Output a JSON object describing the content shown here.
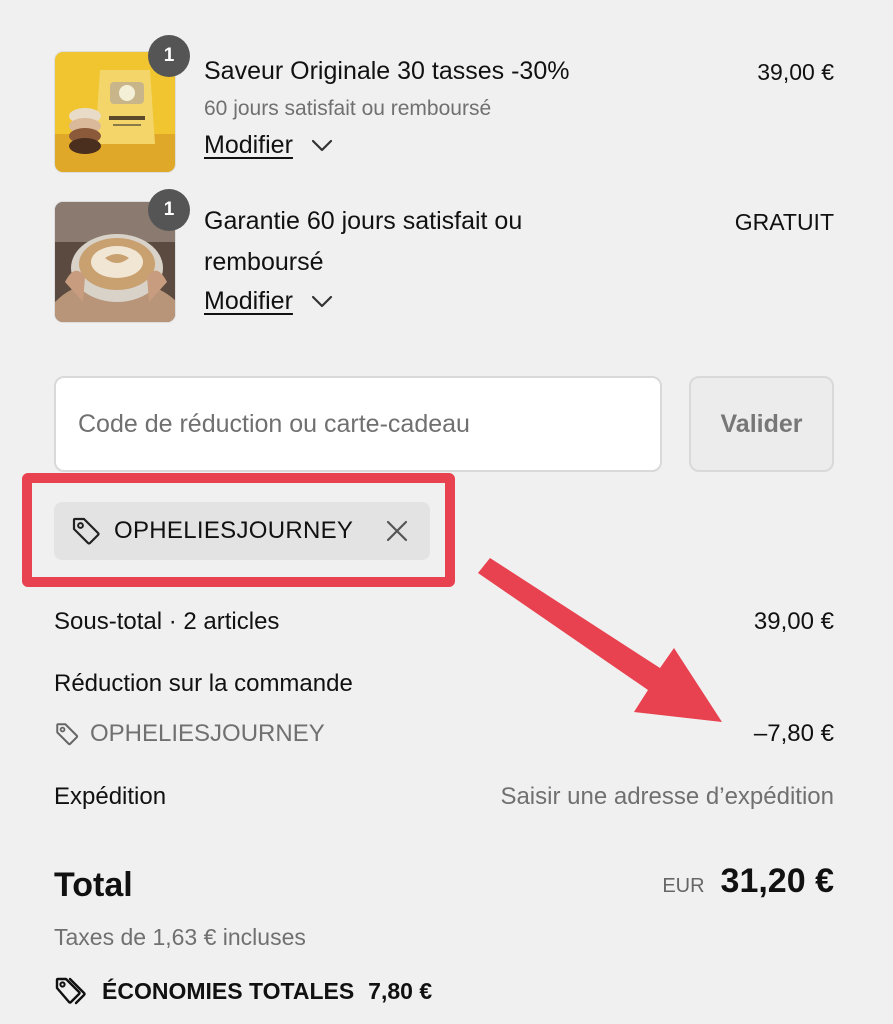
{
  "cart": {
    "items": [
      {
        "quantity": "1",
        "title": "Saveur Originale 30 tasses -30%",
        "subtitle": "60 jours satisfait ou remboursé",
        "price": "39,00 €",
        "modify_label": "Modifier",
        "image_icon": "coffee-bag-product-image"
      },
      {
        "quantity": "1",
        "title": "Garantie 60 jours satisfait ou remboursé",
        "price": "GRATUIT",
        "modify_label": "Modifier",
        "image_icon": "latte-cup-product-image"
      }
    ]
  },
  "discount": {
    "placeholder": "Code de réduction ou carte-cadeau",
    "value": "",
    "submit_label": "Valider",
    "applied_code": "OPHELIESJOURNEY",
    "tag_icon": "tag-icon",
    "remove_icon": "close-icon"
  },
  "summary": {
    "subtotal_label": "Sous-total · 2 articles",
    "subtotal_value": "39,00 €",
    "order_discount_label": "Réduction sur la commande",
    "order_discount_code": "OPHELIESJOURNEY",
    "order_discount_value": "–7,80 €",
    "shipping_label": "Expédition",
    "shipping_value": "Saisir une adresse d’expédition",
    "total_label": "Total",
    "total_currency": "EUR",
    "total_value": "31,20 €",
    "taxes_text": "Taxes de 1,63 € incluses",
    "savings_label": "ÉCONOMIES TOTALES",
    "savings_value": "7,80 €"
  },
  "annotation": {
    "highlight_color": "#e8414f",
    "arrow_color": "#e8414f"
  }
}
